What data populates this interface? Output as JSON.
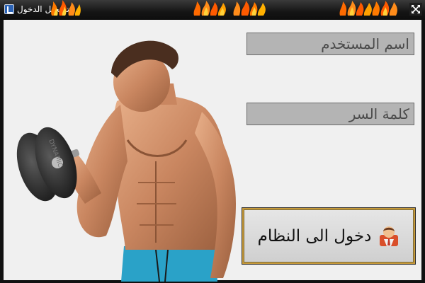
{
  "window": {
    "title": "تسجيل الدخول",
    "icon": "app-icon",
    "decoration": "flame-icon",
    "control": "resize-icon"
  },
  "form": {
    "username_placeholder": "اسم المستخدم",
    "password_placeholder": "كلمة السر",
    "login_label": "دخول الى النظام",
    "login_icon": "user-icon"
  },
  "colors": {
    "field_bg": "#b4b4b4",
    "client_bg": "#f0f0f0",
    "button_border": "#c79a3a",
    "titlebar_bg": "#151515"
  }
}
